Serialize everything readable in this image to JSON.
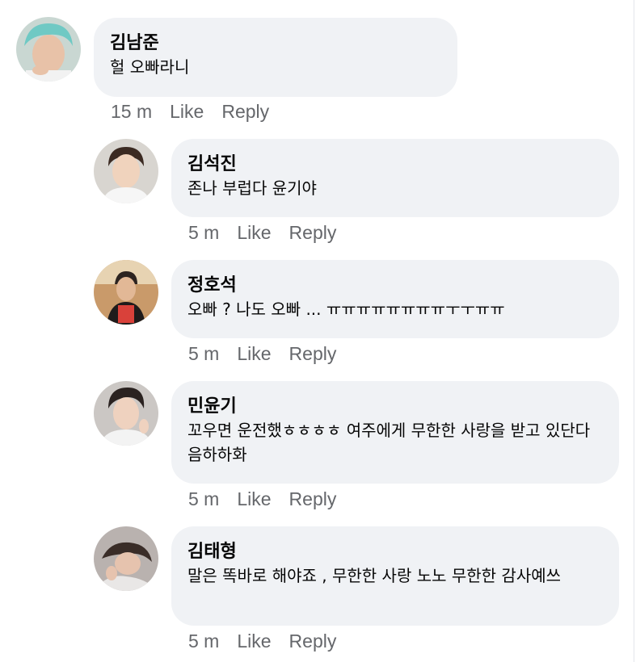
{
  "comments": [
    {
      "author": "김남준",
      "text": "헐 오빠라니",
      "time": "15 m",
      "like": "Like",
      "reply": "Reply"
    },
    {
      "author": "김석진",
      "text": "존나 부럽다 윤기야",
      "time": "5 m",
      "like": "Like",
      "reply": "Reply"
    },
    {
      "author": "정호석",
      "text": "오빠 ? 나도 오빠 ... ㅠㅠㅠㅠㅠㅠㅠㅠㅜㅜㅠㅠ",
      "time": "5 m",
      "like": "Like",
      "reply": "Reply"
    },
    {
      "author": "민윤기",
      "text": "꼬우면 운전했ㅎㅎㅎㅎ 여주에게 무한한 사랑을 받고 있단다 음하하화",
      "time": "5 m",
      "like": "Like",
      "reply": "Reply"
    },
    {
      "author": "김태형",
      "text": "말은 똑바로 해야죠 , 무한한 사랑 노노 무한한 감사예쓰",
      "time": "5 m",
      "like": "Like",
      "reply": "Reply"
    }
  ]
}
